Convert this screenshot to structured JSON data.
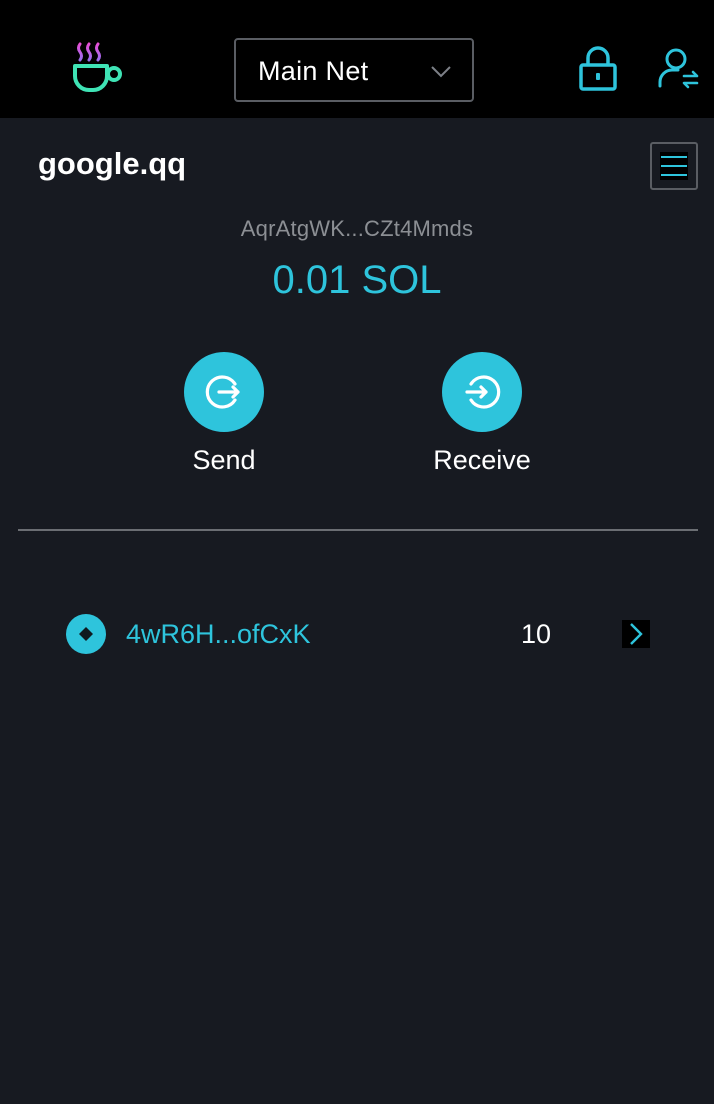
{
  "header": {
    "logo_icon": "coffee-cup-logo-icon",
    "network": {
      "selected": "Main Net",
      "chevron_icon": "chevron-down-icon"
    },
    "lock_icon": "lock-icon",
    "account_icon": "account-switch-icon"
  },
  "account": {
    "name": "google.qq",
    "menu_icon": "hamburger-menu-icon",
    "address_short": "AqrAtgWK...CZt4Mmds",
    "balance": "0.01 SOL"
  },
  "actions": {
    "send_label": "Send",
    "send_icon": "send-out-icon",
    "receive_label": "Receive",
    "receive_icon": "receive-in-icon"
  },
  "tokens": [
    {
      "name": "4wR6H...ofCxK",
      "amount": "10",
      "icon": "token-diamond-icon",
      "arrow_icon": "chevron-right-icon"
    }
  ],
  "colors": {
    "accent": "#2ec4dc",
    "background": "#171a21",
    "header_background": "#000000",
    "logo_pink": "#e64fd6",
    "logo_green": "#3fe3b5"
  }
}
